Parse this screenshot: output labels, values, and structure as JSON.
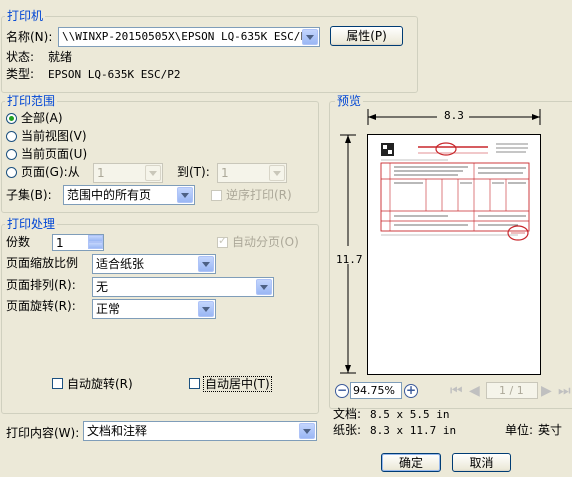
{
  "printer": {
    "legend": "打印机",
    "name_label": "名称(N):",
    "name_value": "\\\\WINXP-20150505X\\EPSON LQ-635K ESC/P2",
    "properties_button": "属性(P)",
    "status_label": "状态:",
    "status_value": "就绪",
    "type_label": "类型:",
    "type_value": "EPSON LQ-635K ESC/P2"
  },
  "range": {
    "legend": "打印范围",
    "all": "全部(A)",
    "current_view": "当前视图(V)",
    "current_page": "当前页面(U)",
    "pages": "页面(G):从",
    "from_value": "1",
    "to_label": "到(T):",
    "to_value": "1",
    "subset_label": "子集(B):",
    "subset_value": "范围中的所有页",
    "reverse_label": "逆序打印(R)"
  },
  "handling": {
    "legend": "打印处理",
    "copies_label": "份数",
    "copies_value": "1",
    "collate_label": "自动分页(O)",
    "scaling_label": "页面缩放比例",
    "scaling_value": "适合纸张",
    "arrange_label": "页面排列(R):",
    "arrange_value": "无",
    "rotate_label": "页面旋转(R):",
    "rotate_value": "正常",
    "auto_rotate_label": "自动旋转(R)",
    "auto_center_label": "自动居中(T)"
  },
  "content": {
    "label": "打印内容(W):",
    "value": "文档和注释"
  },
  "preview": {
    "legend": "预览",
    "width_dim": "8.3",
    "height_dim": "11.7",
    "zoom_value": "94.75%",
    "page_indicator": "1 / 1",
    "doc_label": "文档:",
    "doc_value": "8.5 x 5.5 in",
    "paper_label": "纸张:",
    "paper_value": "8.3 x 11.7 in",
    "unit_label": "单位:",
    "unit_value": "英寸"
  },
  "buttons": {
    "ok": "确定",
    "cancel": "取消"
  },
  "colors": {
    "legend_text": "#0046d5",
    "dialog_bg": "#ece9d8",
    "stamp_red": "#c8262b"
  }
}
